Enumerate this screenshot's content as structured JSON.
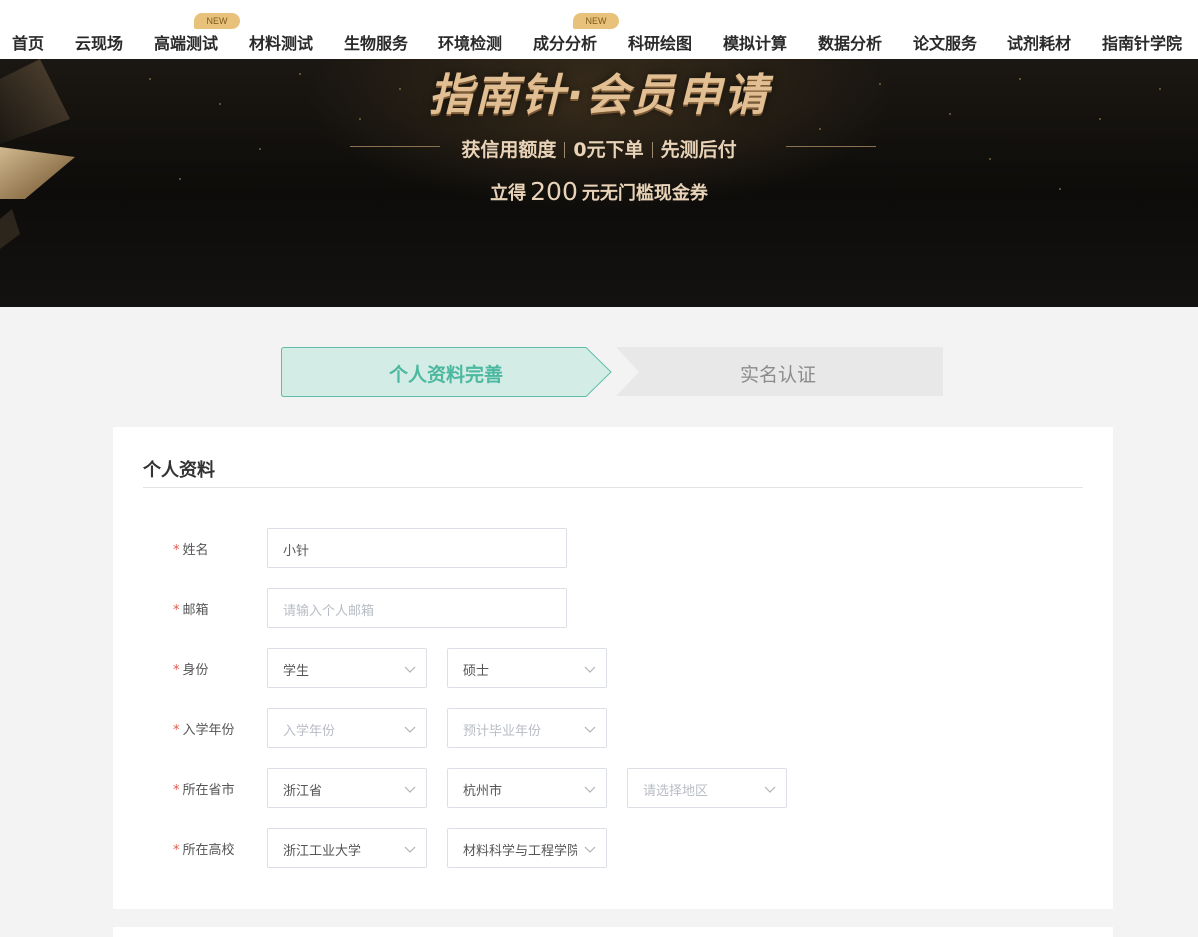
{
  "nav": {
    "items": [
      {
        "label": "首页"
      },
      {
        "label": "云现场"
      },
      {
        "label": "高端测试",
        "badge": "NEW"
      },
      {
        "label": "材料测试"
      },
      {
        "label": "生物服务"
      },
      {
        "label": "环境检测"
      },
      {
        "label": "成分分析",
        "badge": "NEW"
      },
      {
        "label": "科研绘图"
      },
      {
        "label": "模拟计算"
      },
      {
        "label": "数据分析"
      },
      {
        "label": "论文服务"
      },
      {
        "label": "试剂耗材"
      },
      {
        "label": "指南针学院"
      }
    ]
  },
  "banner": {
    "title": "指南针·会员申请",
    "sub_1": "获信用额度",
    "sub_2": "0元下单",
    "sub_3": "先测后付",
    "coupon_pre": "立得",
    "coupon_amount": "200",
    "coupon_post": "元无门槛现金券"
  },
  "steps": {
    "active": "个人资料完善",
    "inactive": "实名认证"
  },
  "form": {
    "section_title": "个人资料",
    "required_mark": "*",
    "name": {
      "label": "姓名",
      "value": "小针"
    },
    "email": {
      "label": "邮箱",
      "placeholder": "请输入个人邮箱"
    },
    "identity": {
      "label": "身份",
      "role": "学生",
      "degree": "硕士"
    },
    "enroll": {
      "label": "入学年份",
      "placeholder_start": "入学年份",
      "placeholder_end": "预计毕业年份"
    },
    "location": {
      "label": "所在省市",
      "province": "浙江省",
      "city": "杭州市",
      "district_placeholder": "请选择地区"
    },
    "school": {
      "label": "所在高校",
      "university": "浙江工业大学",
      "college": "材料科学与工程学院"
    }
  },
  "colors": {
    "accent": "#4cb89f",
    "step_active_bg": "#d4ece6",
    "step_inactive_bg": "#e8e8e8",
    "required": "#e05a4b",
    "badge": "#e8c27a"
  }
}
